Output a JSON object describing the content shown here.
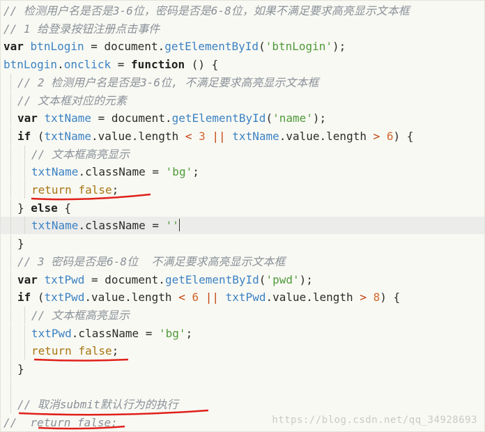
{
  "code_lines": [
    {
      "indent": 0,
      "tokens": [
        [
          "// 检测用户名是否是3-6位，密码是否是6-8位，如果不满足要求高亮显示文本框",
          "comment"
        ]
      ]
    },
    {
      "indent": 0,
      "tokens": [
        [
          "// 1 给登录按钮注册点击事件",
          "comment"
        ]
      ]
    },
    {
      "indent": 0,
      "tokens": [
        [
          "var",
          "kw-strong"
        ],
        [
          " ",
          "plain"
        ],
        [
          "btnLogin",
          "ident"
        ],
        [
          " = document.",
          "plain"
        ],
        [
          "getElementById",
          "fn"
        ],
        [
          "(",
          "plain"
        ],
        [
          "'btnLogin'",
          "str"
        ],
        [
          ");",
          "plain"
        ]
      ]
    },
    {
      "indent": 0,
      "tokens": [
        [
          "btnLogin",
          "ident"
        ],
        [
          ".",
          "plain"
        ],
        [
          "onclick",
          "ident"
        ],
        [
          " = ",
          "plain"
        ],
        [
          "function",
          "kw-strong"
        ],
        [
          " () {",
          "plain"
        ]
      ]
    },
    {
      "indent": 1,
      "tokens": [
        [
          "// 2 检测用户名是否是3-6位, 不满足要求高亮显示文本框",
          "comment"
        ]
      ]
    },
    {
      "indent": 1,
      "tokens": [
        [
          "// 文本框对应的元素",
          "comment"
        ]
      ]
    },
    {
      "indent": 1,
      "tokens": [
        [
          "var",
          "kw-strong"
        ],
        [
          " ",
          "plain"
        ],
        [
          "txtName",
          "ident"
        ],
        [
          " = document.",
          "plain"
        ],
        [
          "getElementById",
          "fn"
        ],
        [
          "(",
          "plain"
        ],
        [
          "'name'",
          "str"
        ],
        [
          ");",
          "plain"
        ]
      ]
    },
    {
      "indent": 1,
      "tokens": [
        [
          "if",
          "kw-strong"
        ],
        [
          " (",
          "plain"
        ],
        [
          "txtName",
          "ident"
        ],
        [
          ".value.length ",
          "plain"
        ],
        [
          "<",
          "op"
        ],
        [
          " ",
          "plain"
        ],
        [
          "3",
          "num"
        ],
        [
          " ",
          "plain"
        ],
        [
          "||",
          "op"
        ],
        [
          " ",
          "plain"
        ],
        [
          "txtName",
          "ident"
        ],
        [
          ".value.length ",
          "plain"
        ],
        [
          ">",
          "op"
        ],
        [
          " ",
          "plain"
        ],
        [
          "6",
          "num"
        ],
        [
          ") {",
          "plain"
        ]
      ]
    },
    {
      "indent": 2,
      "tokens": [
        [
          "// 文本框高亮显示",
          "comment"
        ]
      ]
    },
    {
      "indent": 2,
      "tokens": [
        [
          "txtName",
          "ident"
        ],
        [
          ".className = ",
          "plain"
        ],
        [
          "'bg'",
          "str"
        ],
        [
          ";",
          "plain"
        ]
      ]
    },
    {
      "indent": 2,
      "tokens": [
        [
          "return",
          "kw"
        ],
        [
          " ",
          "plain"
        ],
        [
          "false",
          "kw"
        ],
        [
          ";",
          "plain"
        ]
      ]
    },
    {
      "indent": 1,
      "tokens": [
        [
          "} ",
          "plain"
        ],
        [
          "else",
          "kw-strong"
        ],
        [
          " {",
          "plain"
        ]
      ]
    },
    {
      "indent": 2,
      "highlight": true,
      "tokens": [
        [
          "txtName",
          "ident"
        ],
        [
          ".className = ",
          "plain"
        ],
        [
          "''",
          "str"
        ]
      ],
      "cursor": true
    },
    {
      "indent": 1,
      "tokens": [
        [
          "}",
          "plain"
        ]
      ]
    },
    {
      "indent": 1,
      "tokens": [
        [
          "// 3 密码是否是6-8位  不满足要求高亮显示文本框",
          "comment"
        ]
      ]
    },
    {
      "indent": 1,
      "tokens": [
        [
          "var",
          "kw-strong"
        ],
        [
          " ",
          "plain"
        ],
        [
          "txtPwd",
          "ident"
        ],
        [
          " = document.",
          "plain"
        ],
        [
          "getElementById",
          "fn"
        ],
        [
          "(",
          "plain"
        ],
        [
          "'pwd'",
          "str"
        ],
        [
          ");",
          "plain"
        ]
      ]
    },
    {
      "indent": 1,
      "tokens": [
        [
          "if",
          "kw-strong"
        ],
        [
          " (",
          "plain"
        ],
        [
          "txtPwd",
          "ident"
        ],
        [
          ".value.length ",
          "plain"
        ],
        [
          "<",
          "op"
        ],
        [
          " ",
          "plain"
        ],
        [
          "6",
          "num"
        ],
        [
          " ",
          "plain"
        ],
        [
          "||",
          "op"
        ],
        [
          " ",
          "plain"
        ],
        [
          "txtPwd",
          "ident"
        ],
        [
          ".value.length ",
          "plain"
        ],
        [
          ">",
          "op"
        ],
        [
          " ",
          "plain"
        ],
        [
          "8",
          "num"
        ],
        [
          ") {",
          "plain"
        ]
      ]
    },
    {
      "indent": 2,
      "tokens": [
        [
          "// 文本框高亮显示",
          "comment"
        ]
      ]
    },
    {
      "indent": 2,
      "tokens": [
        [
          "txtPwd",
          "ident"
        ],
        [
          ".className = ",
          "plain"
        ],
        [
          "'bg'",
          "str"
        ],
        [
          ";",
          "plain"
        ]
      ]
    },
    {
      "indent": 2,
      "tokens": [
        [
          "return",
          "kw"
        ],
        [
          " ",
          "plain"
        ],
        [
          "false",
          "kw"
        ],
        [
          ";",
          "plain"
        ]
      ]
    },
    {
      "indent": 1,
      "tokens": [
        [
          "}",
          "plain"
        ]
      ]
    },
    {
      "indent": 1,
      "tokens": []
    },
    {
      "indent": 1,
      "tokens": [
        [
          "// 取消submit默认行为的执行",
          "comment"
        ]
      ]
    },
    {
      "indent": 0,
      "tokens": [
        [
          "//  return false;",
          "comment"
        ]
      ]
    }
  ],
  "watermark": "https://blog.csdn.net/qq_34928693",
  "colors": {
    "comment": "#8a9199",
    "keyword": "#a87512",
    "identifier": "#3b82c4",
    "string": "#4f9a3a",
    "number": "#d0662c",
    "annotation": "#e0201a"
  }
}
